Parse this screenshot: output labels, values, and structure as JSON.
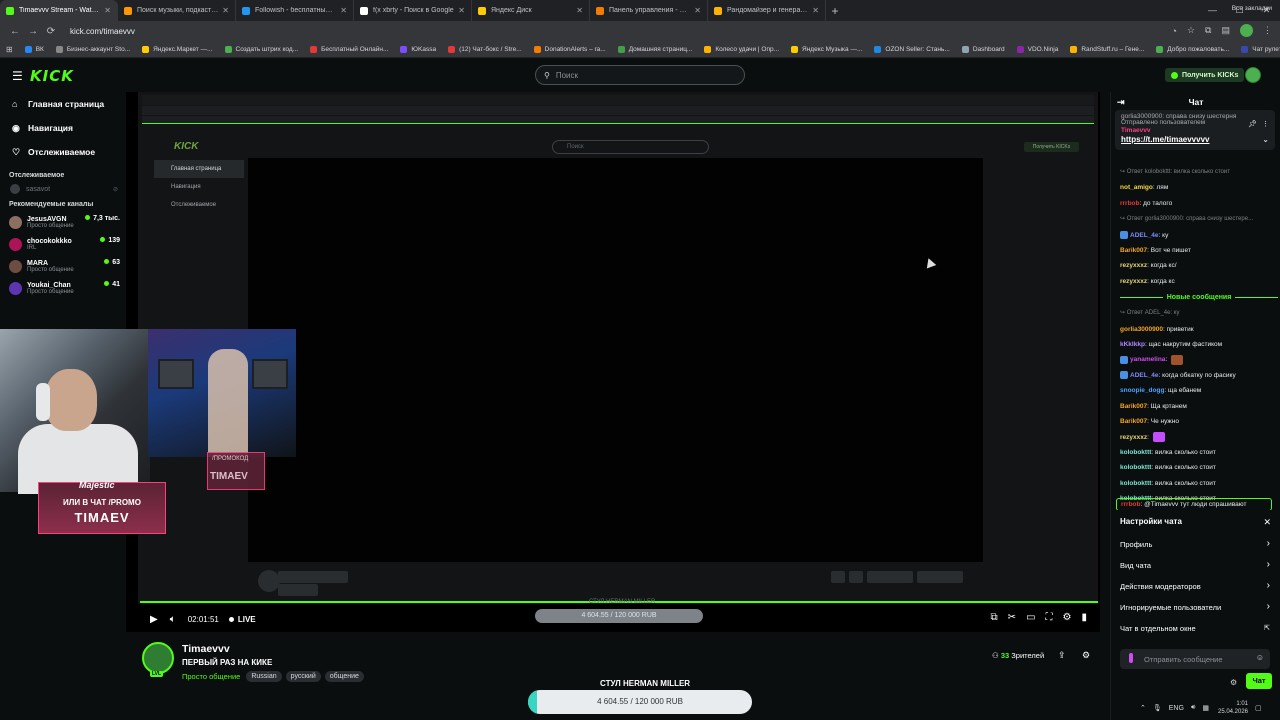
{
  "browser": {
    "tabs": [
      {
        "label": "Timaevvv Stream - Watch Live ...",
        "color": "#53fc18",
        "active": true
      },
      {
        "label": "Поиск музыки, подкасто...",
        "color": "#ff9800",
        "active": false
      },
      {
        "label": "Followish - бесплатный сервис",
        "color": "#2196f3",
        "active": false
      },
      {
        "label": "f(x xbrty - Поиск в Google",
        "color": "#ffffff",
        "active": false
      },
      {
        "label": "Яндекс Диск",
        "color": "#ffcc00",
        "active": false
      },
      {
        "label": "Панель управления - Donatio...",
        "color": "#f57c00",
        "active": false
      },
      {
        "label": "Рандомайзер и генератор слу...",
        "color": "#ffb300",
        "active": false
      }
    ],
    "url": "kick.com/timaevvv",
    "bookmarks": [
      {
        "label": "ВК",
        "color": "#2787f5"
      },
      {
        "label": "Бизнес-аккаунт Sto...",
        "color": "#888888"
      },
      {
        "label": "Яндекс.Маркет —...",
        "color": "#ffcc00"
      },
      {
        "label": "Создать штрих код...",
        "color": "#4caf50"
      },
      {
        "label": "Бесплатный Онлайн...",
        "color": "#e53935"
      },
      {
        "label": "ЮKassa",
        "color": "#7c4dff"
      },
      {
        "label": "(12) Чат-бокс / Stre...",
        "color": "#e53935"
      },
      {
        "label": "DonationAlerts – ra...",
        "color": "#f57c00"
      },
      {
        "label": "Домашняя страниц...",
        "color": "#43a047"
      },
      {
        "label": "Колесо удачи | Опр...",
        "color": "#ffb300"
      },
      {
        "label": "Яндекс Музыка —...",
        "color": "#ffcc00"
      },
      {
        "label": "OZON Seller: Стань...",
        "color": "#1e88e5"
      },
      {
        "label": "Dashboard",
        "color": "#90a4ae"
      },
      {
        "label": "VDO.Ninja",
        "color": "#8e24aa"
      },
      {
        "label": "RandStuff.ru – Гене...",
        "color": "#ffb300"
      },
      {
        "label": "Добро пожаловать...",
        "color": "#4caf50"
      },
      {
        "label": "Чат рулетка голосо...",
        "color": "#3949ab"
      }
    ],
    "all_bookmarks": "Все закладки"
  },
  "kick": {
    "logo": "KICK",
    "search_placeholder": "Поиск",
    "get_kicks": "Получить KICKs"
  },
  "sidebar": {
    "nav": [
      {
        "label": "Главная страница",
        "icon": "home-icon",
        "glyph": "⌂"
      },
      {
        "label": "Навигация",
        "icon": "compass-icon",
        "glyph": "◉"
      },
      {
        "label": "Отслеживаемое",
        "icon": "heart-icon",
        "glyph": "♡"
      }
    ],
    "following_title": "Отслеживаемое",
    "following": [
      {
        "name": "sasavot",
        "status": "offline"
      }
    ],
    "recommended_title": "Рекомендуемые каналы",
    "recommended": [
      {
        "name": "JesusAVGN",
        "category": "Просто общение",
        "viewers": "7,3 тыс.",
        "color": "#8d6e63"
      },
      {
        "name": "chocokokkko",
        "category": "IRL",
        "viewers": "139",
        "color": "#ad1457"
      },
      {
        "name": "MARA",
        "category": "Просто общение",
        "viewers": "63",
        "color": "#6d4c41"
      },
      {
        "name": "Youkai_Chan",
        "category": "Просто общение",
        "viewers": "41",
        "color": "#5e35b1"
      }
    ]
  },
  "player": {
    "elapsed": "02:01:51",
    "live_label": "LIVE",
    "goal_small_title": "СТУЛ HERMAN MILLER",
    "goal_small_text": "4 604.55 / 120 000 RUB",
    "promo_name": "Majestic",
    "promo_text": "ИЛИ В ЧАТ /PROMO",
    "promo_code": "TIMAEV",
    "promo_small": "/ПРОМОКОД",
    "inner_search": "Поиск",
    "inner_kicks": "Получить KICKs",
    "inner_nav": [
      "Главная страница",
      "Навигация",
      "Отслеживаемое"
    ]
  },
  "stream": {
    "streamer": "Timaevvv",
    "title": "ПЕРВЫЙ РАЗ НА КИКЕ",
    "category": "Просто общение",
    "tags": [
      "Russian",
      "русский",
      "общение"
    ],
    "viewers_count": "33",
    "viewers_label": "Зрителей",
    "level_badge": "LVL"
  },
  "goal": {
    "title": "СТУЛ HERMAN MILLER",
    "text": "4 604.55 / 120 000 RUB",
    "fraction": 0.0384
  },
  "chat": {
    "title": "Чат",
    "pinned_prev": "gorlia3000900: справа снизу шестерня",
    "pinned_by": "Отправлено пользователем",
    "pinned_user": "Timaevvv",
    "pinned_link": "https://t.me/timaevvvvv",
    "messages": [
      {
        "reply": "Ответ kolobokttt: вилка сколько стоит"
      },
      {
        "user": "not_amigo",
        "color": "#f5d547",
        "text": "лям"
      },
      {
        "user": "rrrbob",
        "color": "#e53935",
        "text": "до талого"
      },
      {
        "reply": "Ответ gorlia3000900: справа снизу шестере..."
      },
      {
        "user": "ADEL_4e",
        "color": "#7c8cff",
        "text": "ку",
        "badge": true
      },
      {
        "user": "Barik007",
        "color": "#f5a623",
        "text": "Вот че пишет"
      },
      {
        "user": "rezyxxxz",
        "color": "#e8d47a",
        "text": "когда кс/"
      },
      {
        "user": "rezyxxxz",
        "color": "#e8d47a",
        "text": "когда кс"
      },
      {
        "divider": "Новые сообщения"
      },
      {
        "reply": "Ответ ADEL_4e: ку"
      },
      {
        "user": "gorlia3000900",
        "color": "#f5a623",
        "text": "приветик"
      },
      {
        "user": "kKkIkkp",
        "color": "#b388ff",
        "text": "щас накрутим фастиком"
      },
      {
        "user": "yanamelina",
        "color": "#d14cf0",
        "text": "",
        "badge": true,
        "emote": "#a0522d"
      },
      {
        "user": "ADEL_4e",
        "color": "#7c8cff",
        "text": "когда обкатку по фасику",
        "badge": true
      },
      {
        "user": "snoopie_dogg",
        "color": "#4aa3ff",
        "text": "ща ебанем"
      },
      {
        "user": "Barik007",
        "color": "#f5a623",
        "text": "Ща кртанем"
      },
      {
        "user": "Barik007",
        "color": "#f5a623",
        "text": "Че нужно"
      },
      {
        "user": "rezyxxxz",
        "color": "#e8d47a",
        "text": "",
        "emote": "#c44dff"
      },
      {
        "user": "kolobokttt",
        "color": "#7ee8d4",
        "text": "вилка сколько стоит"
      },
      {
        "user": "kolobokttt",
        "color": "#7ee8d4",
        "text": "вилка сколько стоит"
      },
      {
        "user": "kolobokttt",
        "color": "#7ee8d4",
        "text": "вилка сколько стоит"
      },
      {
        "user": "kolobokttt",
        "color": "#7ee8d4",
        "text": "вилка сколько стоит"
      },
      {
        "user": "kolobokttt",
        "color": "#7ee8d4",
        "text": "вилка сколько стоит"
      }
    ],
    "last_user": "rrrbob",
    "last_text": "@Timaevvv тут люди спрашивают",
    "settings": {
      "title": "Настройки чата",
      "items": [
        "Профиль",
        "Вид чата",
        "Действия модераторов",
        "Игнорируемые пользователи",
        "Чат в отдельном окне"
      ]
    },
    "input_placeholder": "Отправить сообщение",
    "send_label": "Чат"
  },
  "tray": {
    "lang": "ENG",
    "time": "1:01",
    "date": "25.04.2026"
  }
}
